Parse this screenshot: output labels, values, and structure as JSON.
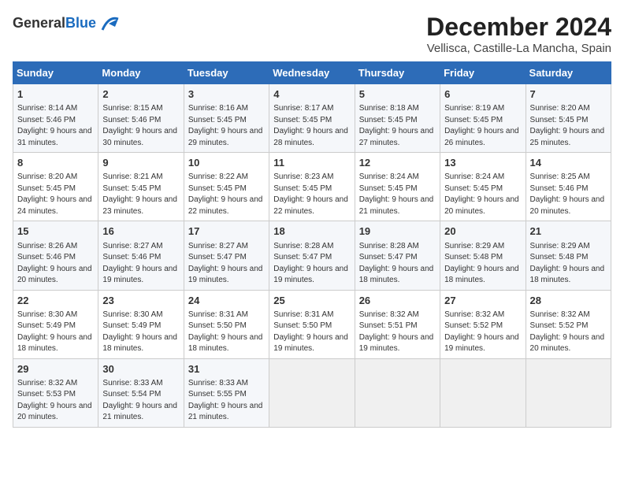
{
  "logo": {
    "general": "General",
    "blue": "Blue"
  },
  "title": "December 2024",
  "location": "Vellisca, Castille-La Mancha, Spain",
  "days_of_week": [
    "Sunday",
    "Monday",
    "Tuesday",
    "Wednesday",
    "Thursday",
    "Friday",
    "Saturday"
  ],
  "weeks": [
    [
      {
        "day": "1",
        "sunrise": "8:14 AM",
        "sunset": "5:46 PM",
        "daylight": "9 hours and 31 minutes."
      },
      {
        "day": "2",
        "sunrise": "8:15 AM",
        "sunset": "5:46 PM",
        "daylight": "9 hours and 30 minutes."
      },
      {
        "day": "3",
        "sunrise": "8:16 AM",
        "sunset": "5:45 PM",
        "daylight": "9 hours and 29 minutes."
      },
      {
        "day": "4",
        "sunrise": "8:17 AM",
        "sunset": "5:45 PM",
        "daylight": "9 hours and 28 minutes."
      },
      {
        "day": "5",
        "sunrise": "8:18 AM",
        "sunset": "5:45 PM",
        "daylight": "9 hours and 27 minutes."
      },
      {
        "day": "6",
        "sunrise": "8:19 AM",
        "sunset": "5:45 PM",
        "daylight": "9 hours and 26 minutes."
      },
      {
        "day": "7",
        "sunrise": "8:20 AM",
        "sunset": "5:45 PM",
        "daylight": "9 hours and 25 minutes."
      }
    ],
    [
      {
        "day": "8",
        "sunrise": "8:20 AM",
        "sunset": "5:45 PM",
        "daylight": "9 hours and 24 minutes."
      },
      {
        "day": "9",
        "sunrise": "8:21 AM",
        "sunset": "5:45 PM",
        "daylight": "9 hours and 23 minutes."
      },
      {
        "day": "10",
        "sunrise": "8:22 AM",
        "sunset": "5:45 PM",
        "daylight": "9 hours and 22 minutes."
      },
      {
        "day": "11",
        "sunrise": "8:23 AM",
        "sunset": "5:45 PM",
        "daylight": "9 hours and 22 minutes."
      },
      {
        "day": "12",
        "sunrise": "8:24 AM",
        "sunset": "5:45 PM",
        "daylight": "9 hours and 21 minutes."
      },
      {
        "day": "13",
        "sunrise": "8:24 AM",
        "sunset": "5:45 PM",
        "daylight": "9 hours and 20 minutes."
      },
      {
        "day": "14",
        "sunrise": "8:25 AM",
        "sunset": "5:46 PM",
        "daylight": "9 hours and 20 minutes."
      }
    ],
    [
      {
        "day": "15",
        "sunrise": "8:26 AM",
        "sunset": "5:46 PM",
        "daylight": "9 hours and 20 minutes."
      },
      {
        "day": "16",
        "sunrise": "8:27 AM",
        "sunset": "5:46 PM",
        "daylight": "9 hours and 19 minutes."
      },
      {
        "day": "17",
        "sunrise": "8:27 AM",
        "sunset": "5:47 PM",
        "daylight": "9 hours and 19 minutes."
      },
      {
        "day": "18",
        "sunrise": "8:28 AM",
        "sunset": "5:47 PM",
        "daylight": "9 hours and 19 minutes."
      },
      {
        "day": "19",
        "sunrise": "8:28 AM",
        "sunset": "5:47 PM",
        "daylight": "9 hours and 18 minutes."
      },
      {
        "day": "20",
        "sunrise": "8:29 AM",
        "sunset": "5:48 PM",
        "daylight": "9 hours and 18 minutes."
      },
      {
        "day": "21",
        "sunrise": "8:29 AM",
        "sunset": "5:48 PM",
        "daylight": "9 hours and 18 minutes."
      }
    ],
    [
      {
        "day": "22",
        "sunrise": "8:30 AM",
        "sunset": "5:49 PM",
        "daylight": "9 hours and 18 minutes."
      },
      {
        "day": "23",
        "sunrise": "8:30 AM",
        "sunset": "5:49 PM",
        "daylight": "9 hours and 18 minutes."
      },
      {
        "day": "24",
        "sunrise": "8:31 AM",
        "sunset": "5:50 PM",
        "daylight": "9 hours and 18 minutes."
      },
      {
        "day": "25",
        "sunrise": "8:31 AM",
        "sunset": "5:50 PM",
        "daylight": "9 hours and 19 minutes."
      },
      {
        "day": "26",
        "sunrise": "8:32 AM",
        "sunset": "5:51 PM",
        "daylight": "9 hours and 19 minutes."
      },
      {
        "day": "27",
        "sunrise": "8:32 AM",
        "sunset": "5:52 PM",
        "daylight": "9 hours and 19 minutes."
      },
      {
        "day": "28",
        "sunrise": "8:32 AM",
        "sunset": "5:52 PM",
        "daylight": "9 hours and 20 minutes."
      }
    ],
    [
      {
        "day": "29",
        "sunrise": "8:32 AM",
        "sunset": "5:53 PM",
        "daylight": "9 hours and 20 minutes."
      },
      {
        "day": "30",
        "sunrise": "8:33 AM",
        "sunset": "5:54 PM",
        "daylight": "9 hours and 21 minutes."
      },
      {
        "day": "31",
        "sunrise": "8:33 AM",
        "sunset": "5:55 PM",
        "daylight": "9 hours and 21 minutes."
      },
      null,
      null,
      null,
      null
    ]
  ],
  "labels": {
    "sunrise": "Sunrise:",
    "sunset": "Sunset:",
    "daylight": "Daylight:"
  }
}
